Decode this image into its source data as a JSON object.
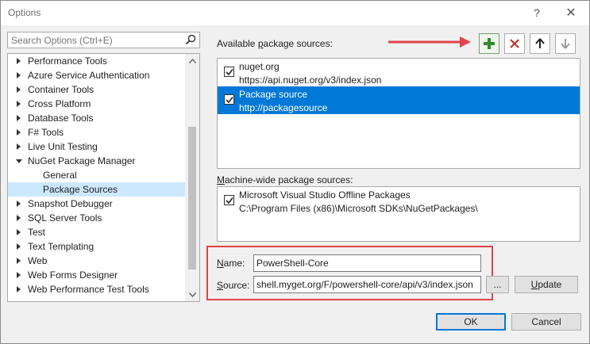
{
  "window": {
    "title": "Options",
    "help": "?",
    "close": "✕"
  },
  "search": {
    "placeholder": "Search Options (Ctrl+E)"
  },
  "tree": {
    "items": [
      {
        "label": "Performance Tools",
        "expanded": false
      },
      {
        "label": "Azure Service Authentication",
        "expanded": false
      },
      {
        "label": "Container Tools",
        "expanded": false
      },
      {
        "label": "Cross Platform",
        "expanded": false
      },
      {
        "label": "Database Tools",
        "expanded": false
      },
      {
        "label": "F# Tools",
        "expanded": false
      },
      {
        "label": "Live Unit Testing",
        "expanded": false
      },
      {
        "label": "NuGet Package Manager",
        "expanded": true
      },
      {
        "label": "General",
        "child": true
      },
      {
        "label": "Package Sources",
        "child": true,
        "selected": true
      },
      {
        "label": "Snapshot Debugger",
        "expanded": false
      },
      {
        "label": "SQL Server Tools",
        "expanded": false
      },
      {
        "label": "Test",
        "expanded": false
      },
      {
        "label": "Text Templating",
        "expanded": false
      },
      {
        "label": "Web",
        "expanded": false
      },
      {
        "label": "Web Forms Designer",
        "expanded": false
      },
      {
        "label": "Web Performance Test Tools",
        "expanded": false
      }
    ]
  },
  "available": {
    "label_prefix": "Available ",
    "label_underlined": "p",
    "label_suffix": "ackage sources:",
    "sources": [
      {
        "name": "nuget.org",
        "url": "https://api.nuget.org/v3/index.json",
        "checked": true,
        "selected": false
      },
      {
        "name": "Package source",
        "url": "http://packagesource",
        "checked": true,
        "selected": true
      }
    ]
  },
  "machine": {
    "label_underlined": "M",
    "label_suffix": "achine-wide package sources:",
    "sources": [
      {
        "name": "Microsoft Visual Studio Offline Packages",
        "url": "C:\\Program Files (x86)\\Microsoft SDKs\\NuGetPackages\\",
        "checked": true
      }
    ]
  },
  "form": {
    "name_label_underlined": "N",
    "name_label_suffix": "ame:",
    "name_value": "PowerShell-Core",
    "source_label_underlined": "S",
    "source_label_suffix": "ource:",
    "source_value": "shell.myget.org/F/powershell-core/api/v3/index.json",
    "browse_label": "...",
    "update_label_underlined": "U",
    "update_label_suffix": "pdate"
  },
  "footer": {
    "ok_label": "OK",
    "cancel_label": "Cancel"
  },
  "colors": {
    "selection": "#0078d7",
    "tree_selection": "#cce8ff",
    "annotation": "#e0434b",
    "add_icon": "#2e8b2e",
    "remove_icon": "#c0392b"
  }
}
